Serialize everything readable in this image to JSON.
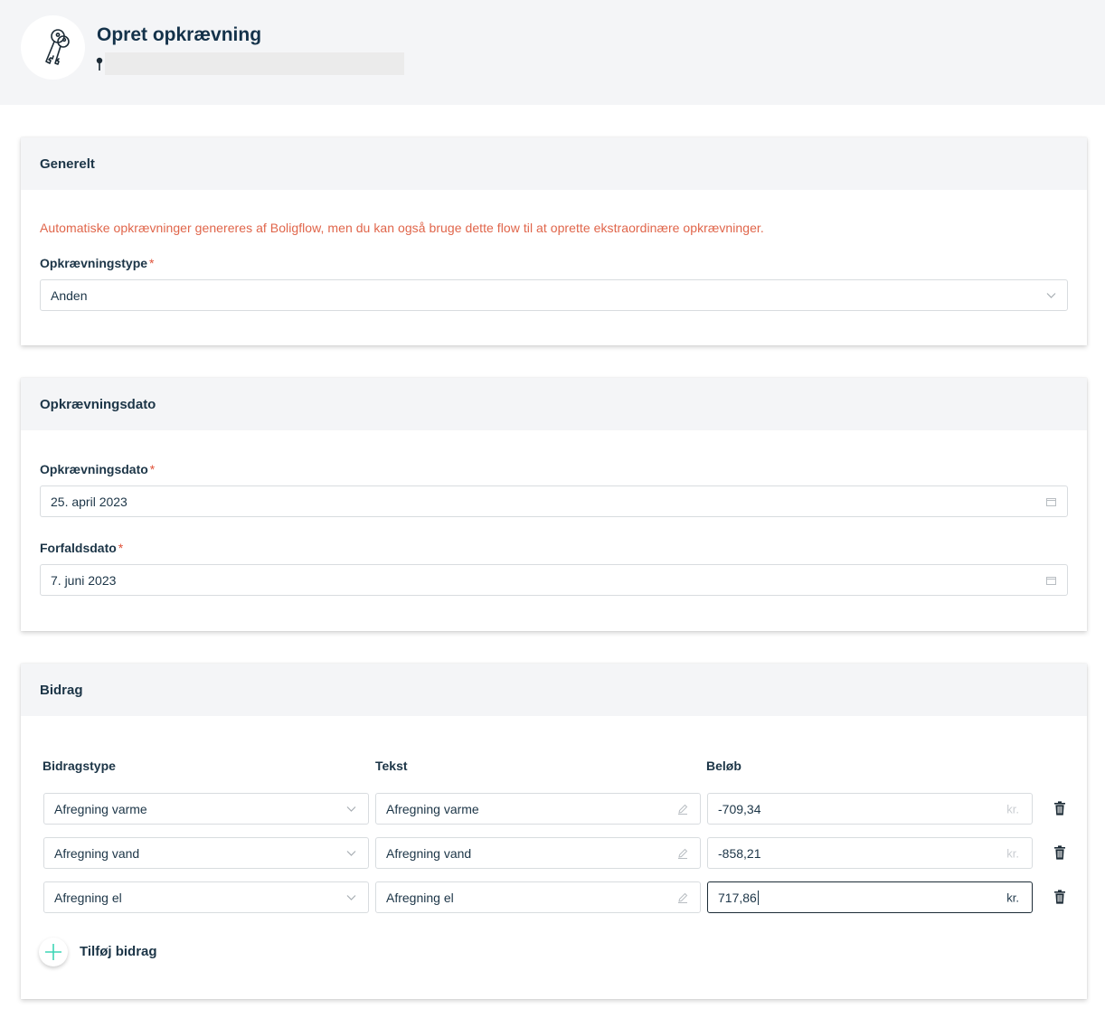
{
  "header": {
    "title": "Opret opkrævning",
    "address": ""
  },
  "general": {
    "heading": "Generelt",
    "notice": "Automatiske opkrævninger genereres af Boligflow, men du kan også bruge dette flow til at oprette ekstraordinære opkrævninger.",
    "type_label": "Opkrævningstype",
    "type_value": "Anden"
  },
  "dates": {
    "heading": "Opkrævningsdato",
    "billing_label": "Opkrævningsdato",
    "billing_value": "25. april 2023",
    "due_label": "Forfaldsdato",
    "due_value": "7. juni 2023"
  },
  "contributions": {
    "heading": "Bidrag",
    "col_type": "Bidragstype",
    "col_text": "Tekst",
    "col_amount": "Beløb",
    "currency": "kr.",
    "rows": [
      {
        "type": "Afregning varme",
        "text": "Afregning varme",
        "amount": "-709,34"
      },
      {
        "type": "Afregning vand",
        "text": "Afregning vand",
        "amount": "-858,21"
      },
      {
        "type": "Afregning el",
        "text": "Afregning el",
        "amount": "717,86"
      }
    ],
    "add_label": "Tilføj bidrag"
  },
  "colors": {
    "required": "#e0533a",
    "notice": "#e0654a",
    "add_accent": "#3dd6b5",
    "heading_text": "#1c3547"
  },
  "icons": {
    "avatar": "keys-icon",
    "address": "pin-icon",
    "dropdown": "chevron-down-icon",
    "date": "calendar-icon",
    "text": "pencil-icon",
    "delete": "trash-icon",
    "add": "plus-icon"
  }
}
